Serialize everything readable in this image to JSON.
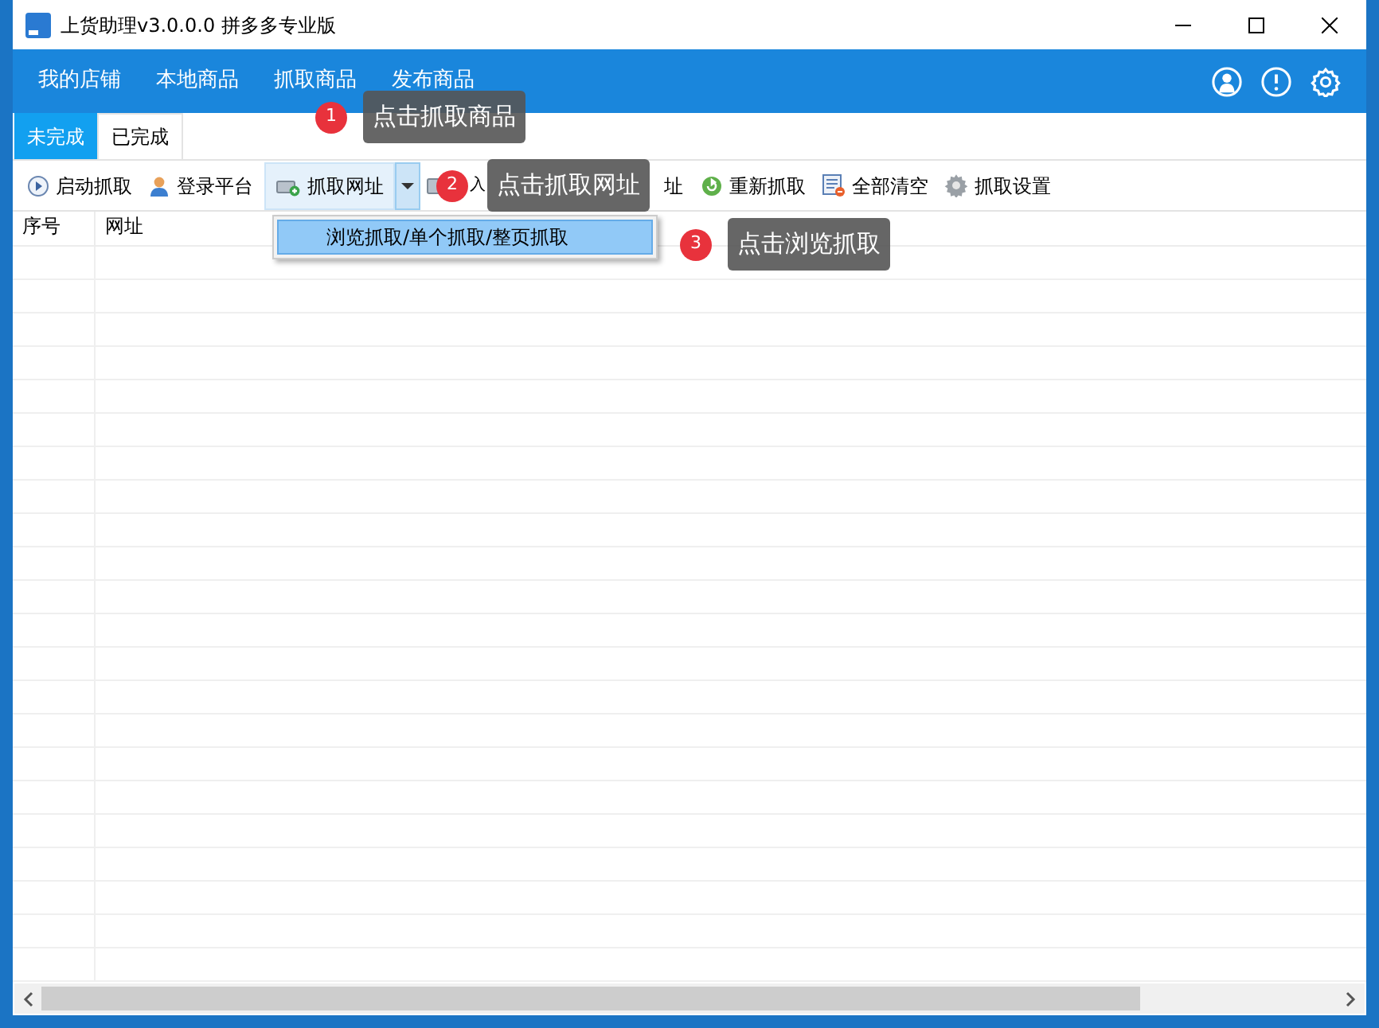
{
  "window": {
    "title": "上货助理v3.0.0.0 拼多多专业版"
  },
  "nav": {
    "items": [
      {
        "label": "我的店铺"
      },
      {
        "label": "本地商品"
      },
      {
        "label": "抓取商品"
      },
      {
        "label": "发布商品"
      }
    ]
  },
  "tabs": [
    {
      "label": "未完成",
      "selected": true
    },
    {
      "label": "已完成",
      "selected": false
    }
  ],
  "toolbar": [
    {
      "label": "启动抓取",
      "kind": "play"
    },
    {
      "label": "登录平台",
      "kind": "user"
    },
    {
      "label": "抓取网址",
      "kind": "fetch",
      "dropdown": true
    },
    {
      "label": "入",
      "kind": "import"
    },
    {
      "label": "址",
      "kind": "fragment"
    },
    {
      "label": "重新抓取",
      "kind": "refresh"
    },
    {
      "label": "全部清空",
      "kind": "clear"
    },
    {
      "label": "抓取设置",
      "kind": "settings"
    }
  ],
  "table": {
    "columns": [
      "序号",
      "网址"
    ]
  },
  "dropdown_menu": {
    "items": [
      {
        "label": "浏览抓取/单个抓取/整页抓取",
        "selected": true
      }
    ]
  },
  "callouts": [
    {
      "number": "1",
      "text": "点击抓取商品"
    },
    {
      "number": "2",
      "text": "点击抓取网址"
    },
    {
      "number": "3",
      "text": "点击浏览抓取"
    }
  ]
}
